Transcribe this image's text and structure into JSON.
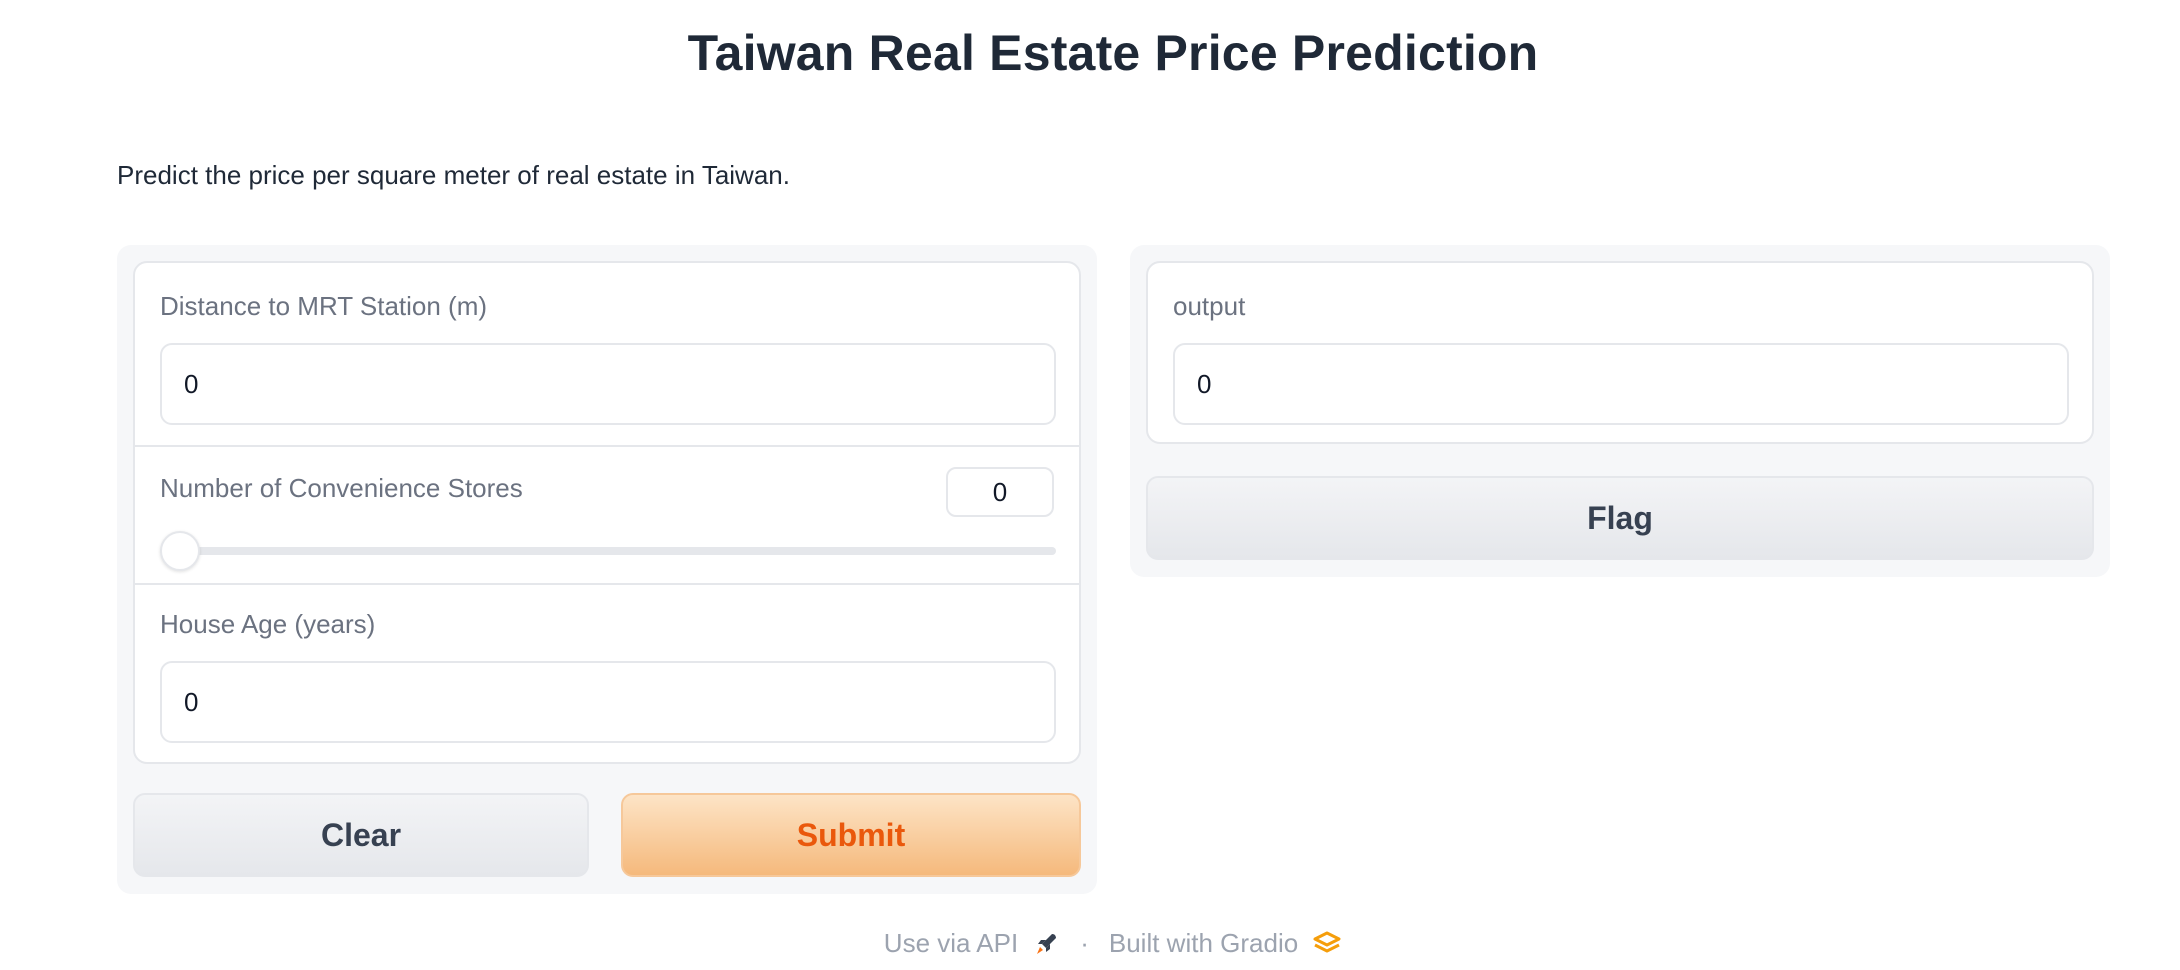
{
  "app": {
    "title": "Taiwan Real Estate Price Prediction",
    "description": "Predict the price per square meter of real estate in Taiwan."
  },
  "inputs": {
    "distance": {
      "label": "Distance to MRT Station (m)",
      "value": "0"
    },
    "stores": {
      "label": "Number of Convenience Stores",
      "value": "0",
      "slider_fraction": 0
    },
    "age": {
      "label": "House Age (years)",
      "value": "0"
    }
  },
  "actions": {
    "clear_label": "Clear",
    "submit_label": "Submit"
  },
  "output": {
    "label": "output",
    "value": "0",
    "flag_label": "Flag"
  },
  "footer": {
    "api_label": "Use via API",
    "separator": "·",
    "built_label": "Built with Gradio"
  },
  "icons": {
    "api": "rocket-icon",
    "gradio": "gradio-logo-icon"
  },
  "colors": {
    "primary_text": "#ea580c",
    "primary_bg": "#f5b97c",
    "gradio_logo": "#f59e0b"
  }
}
